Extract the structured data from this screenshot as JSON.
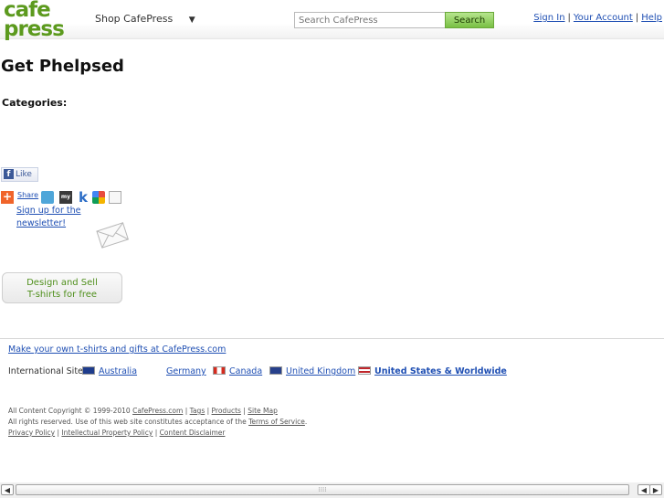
{
  "header": {
    "logo_line1": "cafe",
    "logo_line2": "press",
    "shop_menu_label": "Shop CafePress",
    "shop_menu_caret": "▼",
    "search_placeholder": "Search CafePress",
    "search_button": "Search",
    "links": [
      "Sign In",
      "Your Account",
      "Help"
    ],
    "link_separator": "|"
  },
  "main": {
    "title": "Get Phelpsed",
    "categories_label": "Categories:",
    "fb_like": "Like",
    "share_label": "Share",
    "myspace_label": "my",
    "k_label": "k",
    "newsletter_link": "Sign up for the newsletter!",
    "design_button_line1": "Design and Sell",
    "design_button_line2": "T-shirts for free"
  },
  "footer": {
    "make_link": "Make your own t-shirts and gifts at CafePress.com",
    "intl_label": "International Sites:",
    "sites": [
      "Australia",
      "Germany",
      "Canada",
      "United Kingdom",
      "United States & Worldwide"
    ],
    "legal_line1_prefix": "All Content Copyright © 1999-2010",
    "legal_line1_links": [
      "CafePress.com",
      "Tags",
      "Products",
      "Site Map"
    ],
    "legal_line2_prefix": "All rights reserved. Use of this web site constitutes acceptance of the",
    "legal_line2_link": "Terms of Service",
    "legal_line3_links": [
      "Privacy Policy",
      "Intellectual Property Policy",
      "Content Disclaimer"
    ]
  },
  "scrollbar": {
    "left_arrow": "◀",
    "right_arrow": "▶",
    "thumb_grip": "⁞⁞⁞⁞"
  },
  "colors": {
    "logo_green": "#5c9a1e",
    "link_blue": "#1f4fb3",
    "search_button_green": "#79c044"
  }
}
